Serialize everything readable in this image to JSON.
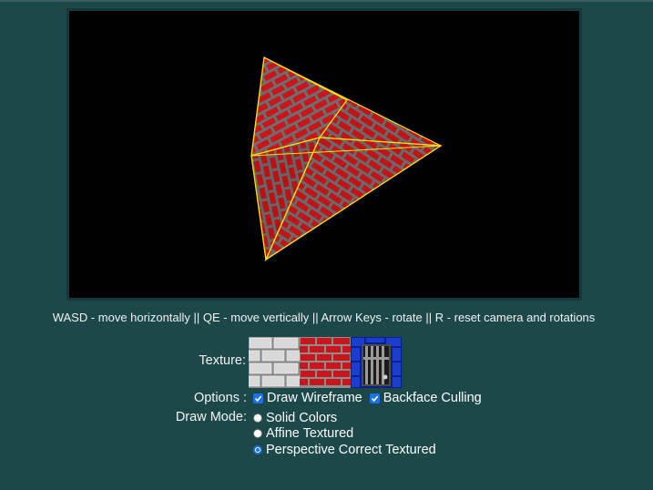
{
  "help_text": "WASD - move horizontally || QE - move vertically || Arrow Keys - rotate || R - reset camera and rotations",
  "texture": {
    "label": "Texture:",
    "items": [
      "gray-bricks-texture",
      "red-bricks-texture",
      "jail-cell-texture"
    ]
  },
  "options": {
    "label": "Options :",
    "draw_wireframe": {
      "label": "Draw Wireframe",
      "checked": true
    },
    "backface_culling": {
      "label": "Backface Culling",
      "checked": true
    }
  },
  "draw_mode": {
    "label": "Draw Mode:",
    "options": [
      {
        "label": "Solid Colors",
        "checked": false
      },
      {
        "label": "Affine Textured",
        "checked": false
      },
      {
        "label": "Perspective Correct Textured",
        "checked": true
      }
    ]
  },
  "colors": {
    "background": "#1c4849",
    "wireframe": "#ffe000",
    "brick_red": "#c8161c",
    "accent": "#1a73e8"
  }
}
